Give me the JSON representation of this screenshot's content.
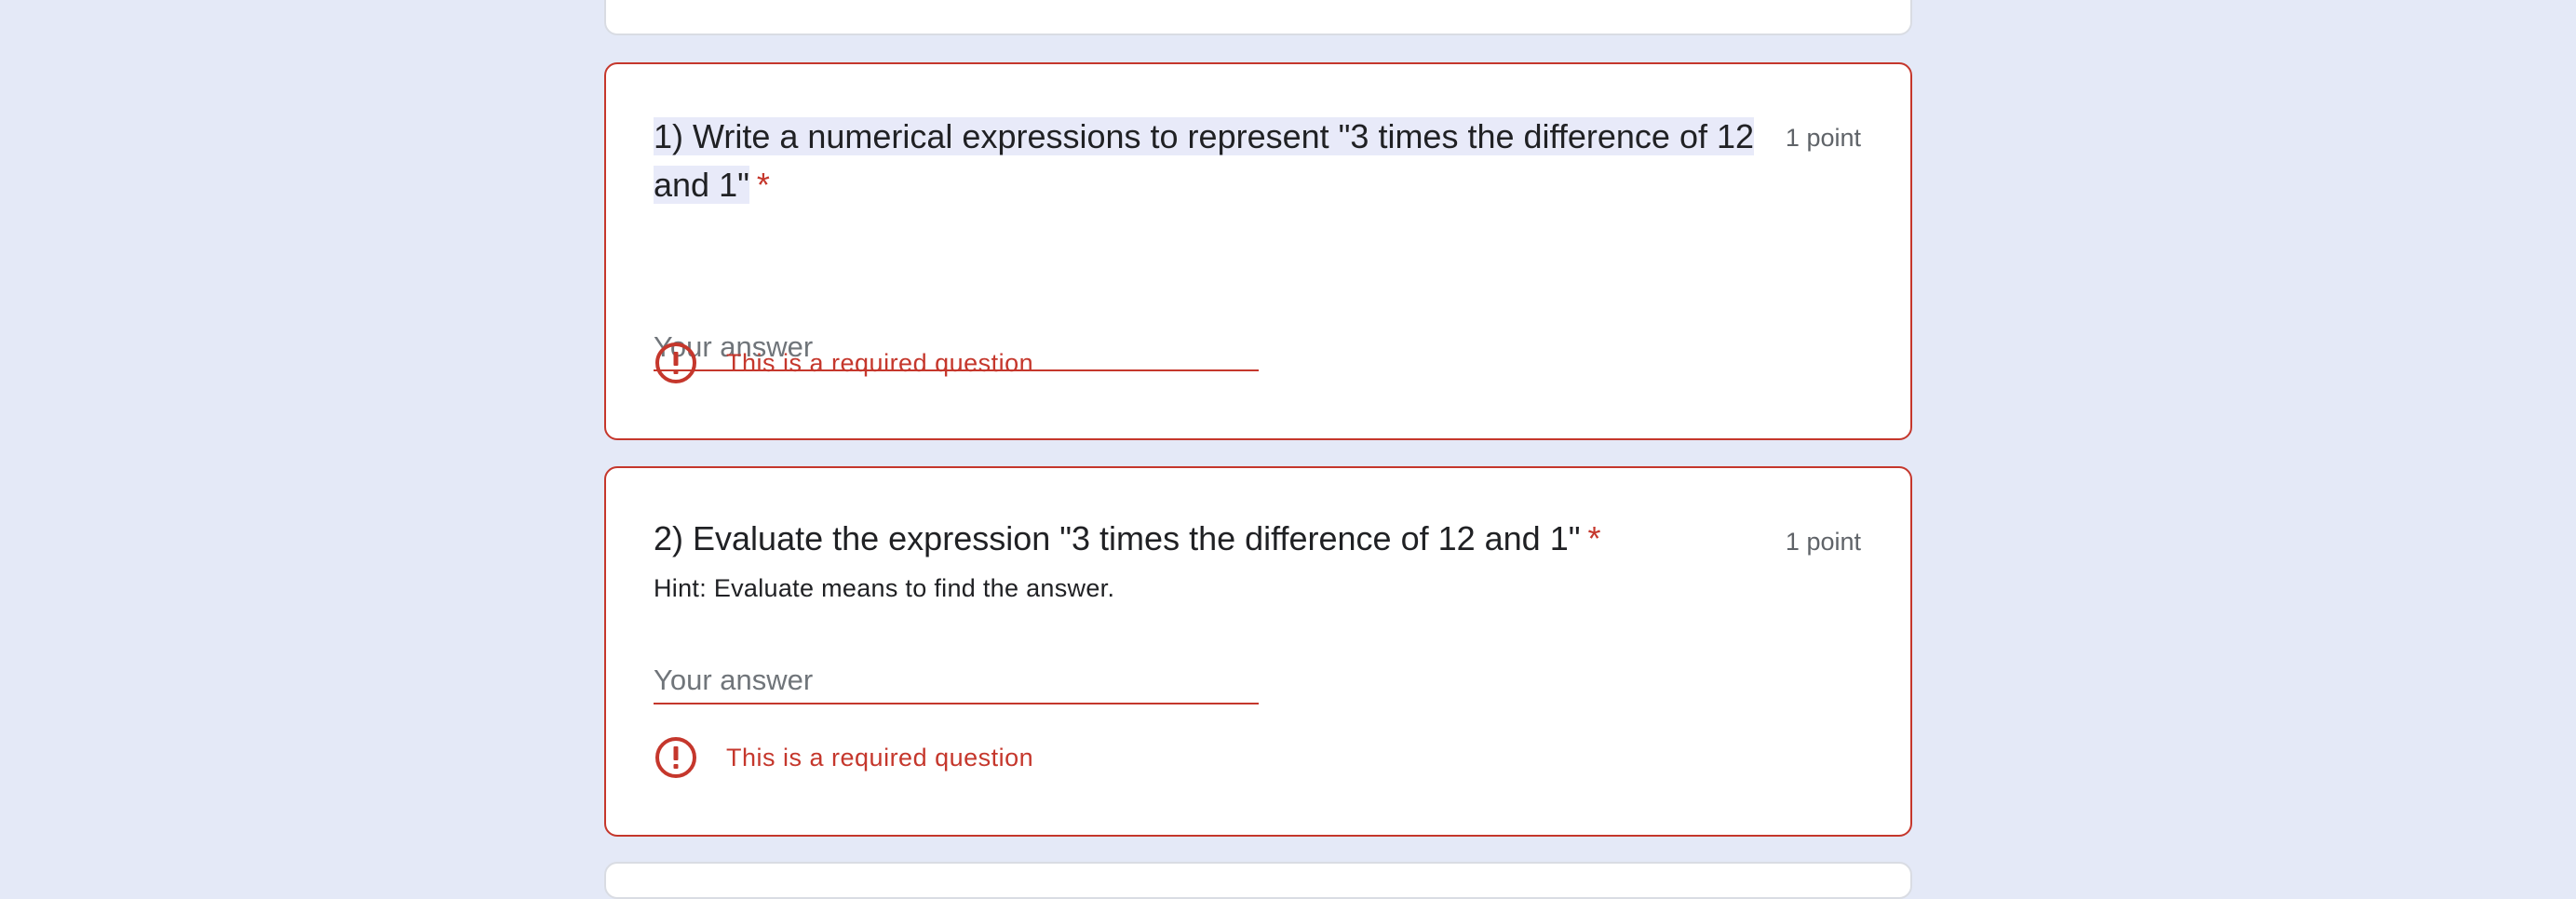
{
  "questions": [
    {
      "title": "1) Write a numerical expressions to represent \"3 times the difference of 12 and 1\"",
      "required_marker": "*",
      "points": "1 point",
      "answer_placeholder": "Your answer",
      "answer_value": "",
      "error_text": "This is a required question"
    },
    {
      "title": "2) Evaluate the expression \"3 times the difference of 12 and 1\"",
      "required_marker": "*",
      "hint": "Hint: Evaluate means to find the answer.",
      "points": "1 point",
      "answer_placeholder": "Your answer",
      "answer_value": "",
      "error_text": "This is a required question"
    }
  ],
  "icons": {
    "error": "error-circle-exclamation"
  },
  "colors": {
    "page_background": "#e4e9f7",
    "error": "#c5372c",
    "selection_highlight": "#e8eaf9"
  }
}
